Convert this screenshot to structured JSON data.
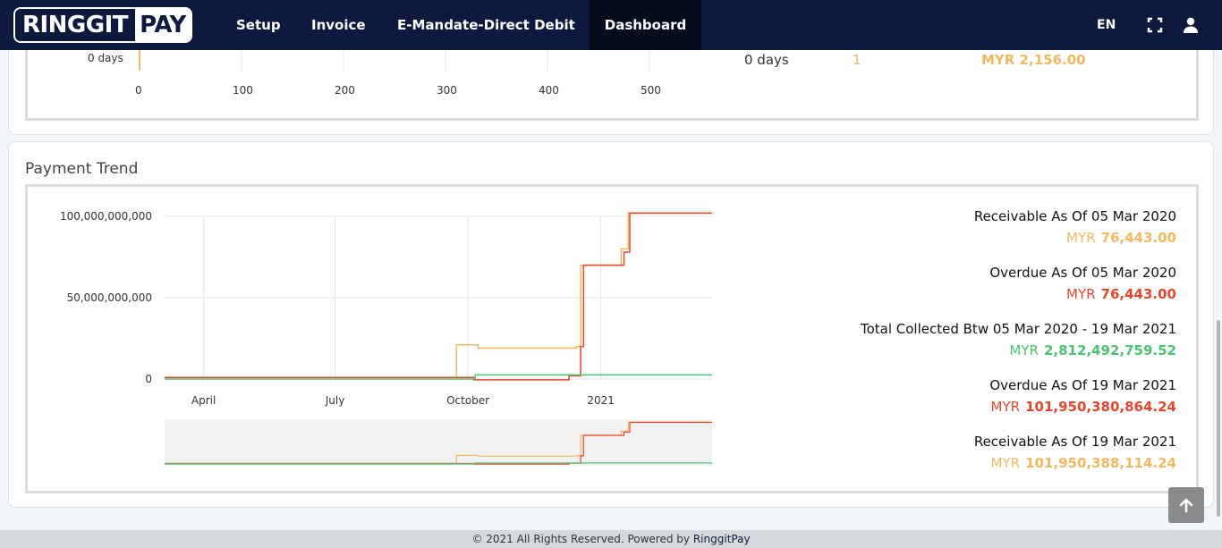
{
  "brand": {
    "left": "RINGGIT",
    "right": "PAY"
  },
  "nav": {
    "items": [
      {
        "label": "Setup"
      },
      {
        "label": "Invoice"
      },
      {
        "label": "E-Mandate-Direct Debit"
      },
      {
        "label": "Dashboard"
      }
    ],
    "language": "EN"
  },
  "aging": {
    "y_tick": "0 days",
    "x_ticks": [
      "0",
      "100",
      "200",
      "300",
      "400",
      "500"
    ],
    "row": {
      "label": "0 days",
      "count": "1",
      "amount": "MYR 2,156.00"
    }
  },
  "payment_trend": {
    "title": "Payment Trend",
    "stats": [
      {
        "label": "Receivable As Of 05 Mar 2020",
        "currency": "MYR",
        "value": "76,443.00",
        "color": "#f4b860"
      },
      {
        "label": "Overdue As Of 05 Mar 2020",
        "currency": "MYR",
        "value": "76,443.00",
        "color": "#e8452c"
      },
      {
        "label": "Total Collected Btw 05 Mar 2020 - 19 Mar 2021",
        "currency": "MYR",
        "value": "2,812,492,759.52",
        "color": "#4cc473"
      },
      {
        "label": "Overdue As Of 19 Mar 2021",
        "currency": "MYR",
        "value": "101,950,380,864.24",
        "color": "#e8452c"
      },
      {
        "label": "Receivable As Of 19 Mar 2021",
        "currency": "MYR",
        "value": "101,950,388,114.24",
        "color": "#f4b860"
      }
    ]
  },
  "chart_data": {
    "type": "line",
    "y_ticks": [
      "100,000,000,000",
      "50,000,000,000",
      "0"
    ],
    "x_ticks": [
      "April",
      "July",
      "October",
      "2021"
    ],
    "x_range": [
      "2020-03-05",
      "2021-03-19"
    ],
    "ylim": [
      0,
      100000000000
    ],
    "grid": true,
    "legend": "none",
    "series": [
      {
        "color": "#f4b860",
        "points": [
          [
            "2020-03-05",
            1000000000
          ],
          [
            "2020-09-23",
            1000000000
          ],
          [
            "2020-09-23",
            21000000000
          ],
          [
            "2020-10-08",
            21000000000
          ],
          [
            "2020-10-08",
            19000000000
          ],
          [
            "2020-12-15",
            19000000000
          ],
          [
            "2020-12-15",
            20000000000
          ],
          [
            "2020-12-18",
            20000000000
          ],
          [
            "2020-12-18",
            70000000000
          ],
          [
            "2021-01-15",
            70000000000
          ],
          [
            "2021-01-15",
            80000000000
          ],
          [
            "2021-01-20",
            80000000000
          ],
          [
            "2021-01-20",
            102000000000
          ],
          [
            "2021-03-19",
            102000000000
          ]
        ]
      },
      {
        "color": "#e8452c",
        "points": [
          [
            "2020-03-05",
            1000000000
          ],
          [
            "2020-10-05",
            1000000000
          ],
          [
            "2020-10-05",
            -500000000
          ],
          [
            "2020-12-10",
            -500000000
          ],
          [
            "2020-12-10",
            2000000000
          ],
          [
            "2020-12-18",
            2000000000
          ],
          [
            "2020-12-18",
            20000000000
          ],
          [
            "2020-12-20",
            20000000000
          ],
          [
            "2020-12-20",
            70000000000
          ],
          [
            "2021-01-17",
            70000000000
          ],
          [
            "2021-01-17",
            78000000000
          ],
          [
            "2021-01-21",
            78000000000
          ],
          [
            "2021-01-21",
            102000000000
          ],
          [
            "2021-03-19",
            102000000000
          ]
        ]
      },
      {
        "color": "#4cc473",
        "points": [
          [
            "2020-03-05",
            0
          ],
          [
            "2020-10-06",
            0
          ],
          [
            "2020-10-06",
            2500000000
          ],
          [
            "2021-03-19",
            2500000000
          ]
        ]
      }
    ]
  },
  "footer": {
    "text": "© 2021 All Rights Reserved. Powered by",
    "brand": "RinggitPay"
  }
}
